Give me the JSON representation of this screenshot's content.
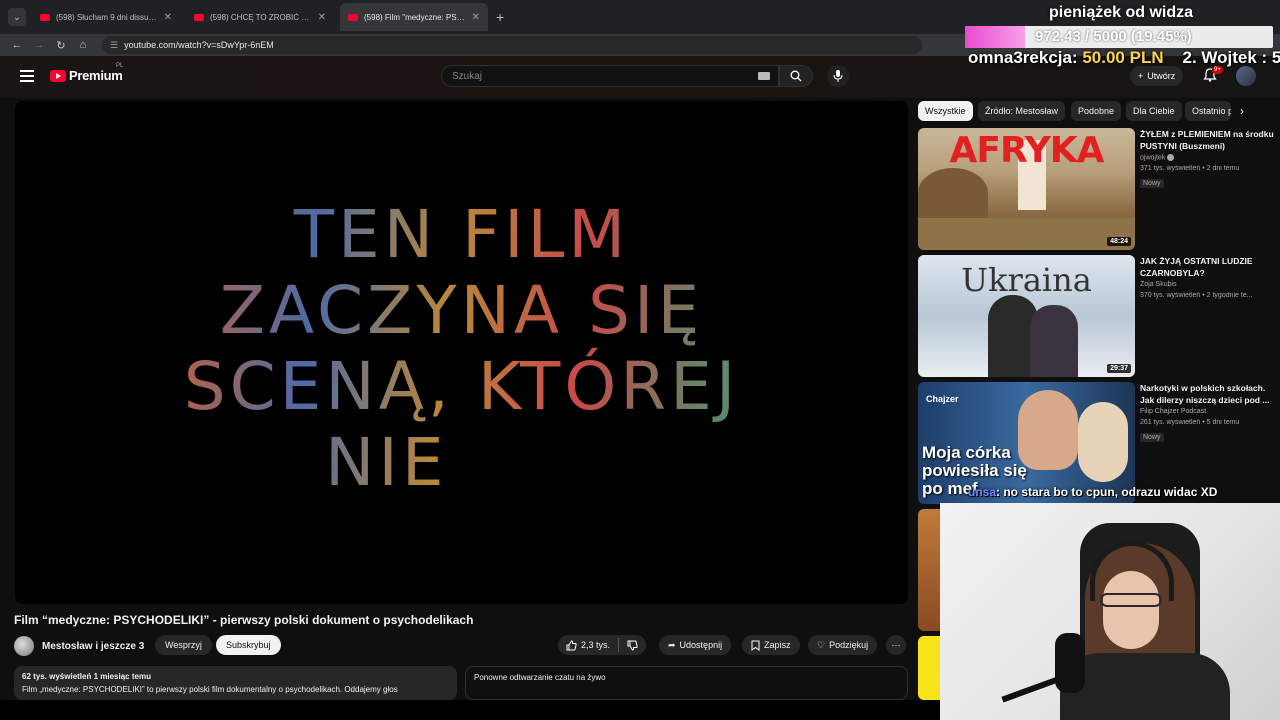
{
  "browser": {
    "tabs": [
      {
        "title": "(598) Słucham 9 dni dissu na ra",
        "active": false
      },
      {
        "title": "(598) CHCĘ TO ZROBIĆ JAKO PI",
        "active": false
      },
      {
        "title": "(598) Film \"medyczne: PSYCHO",
        "active": true
      }
    ],
    "new_tab": "+",
    "url": "youtube.com/watch?v=sDwYpr-6nEM"
  },
  "overlay": {
    "donation_title": "pieniążek od widza",
    "donation_amount": "972.43 / 5000 (19.45%)",
    "donation_progress": 0.1945,
    "ticker_prefix": "omna3rekcja: ",
    "ticker_amount": "50.00 PLN",
    "ticker_suffix": "    2. Wojtek : 5",
    "chat_user": "unsa",
    "chat_text": ": no stara bo to cpun, odrazu widac XD"
  },
  "youtube": {
    "logo_text": "Premium",
    "logo_region": "PL",
    "search_placeholder": "Szukaj",
    "create_label": "Utwórz",
    "notif_badge": "9+",
    "video_overlay_lines": [
      "TEN FILM",
      "ZACZYNA SIĘ",
      "SCENĄ, KTÓREJ",
      "NIE"
    ],
    "video_title": "Film “medyczne: PSYCHODELIKI” - pierwszy polski dokument o psychodelikach",
    "channel_name": "Mestosław i jeszcze 3",
    "support_label": "Wesprzyj",
    "subscribe_label": "Subskrybuj",
    "likes": "2,3 tys.",
    "share_label": "Udostępnij",
    "save_label": "Zapisz",
    "thanks_label": "Podziękuj",
    "desc_meta": "62 tys. wyświetleń  1 miesiąc temu",
    "desc_snippet": "Film „medyczne: PSYCHODELIKI” to pierwszy polski film dokumentalny o psychodelikach. Oddajemy głos",
    "replay_text": "Ponowne odtwarzanie czatu na żywo",
    "chips": [
      "Wszystkie",
      "Źródło: Mestosław",
      "Podobne",
      "Dla Ciebie",
      "Ostatnio p"
    ],
    "recommendations": [
      {
        "title": "ŻYŁEM z PLEMIENIEM na środku PUSTYNI (Buszmeni)",
        "channel": "ojwojtek",
        "verified": true,
        "meta": "371 tys. wyświetleń • 2 dni temu",
        "badge": "Nowy",
        "duration": "48:24",
        "thumb_text": "AFRYKA"
      },
      {
        "title": "JAK ŻYJĄ OSTATNI LUDZIE CZARNOBYLA?",
        "channel": "Zoja Skubis",
        "verified": false,
        "meta": "370 tys. wyświetleń • 2 tygodnie te...",
        "badge": "",
        "duration": "29:37",
        "thumb_text": "Ukraina"
      },
      {
        "title": "Narkotyki w polskich szkołach. Jak dilerzy niszczą dzieci pod ...",
        "channel": "Filip Chajzer Podcast",
        "verified": false,
        "meta": "261 tys. wyświetleń • 5 dni temu",
        "badge": "Nowy",
        "duration": "",
        "thumb_text": "Moja córka powiesiła się po mef",
        "thumb_brand": "Chajzer"
      }
    ]
  },
  "colors": {
    "accent": "#ff0033",
    "progress": "#e84bd0"
  }
}
